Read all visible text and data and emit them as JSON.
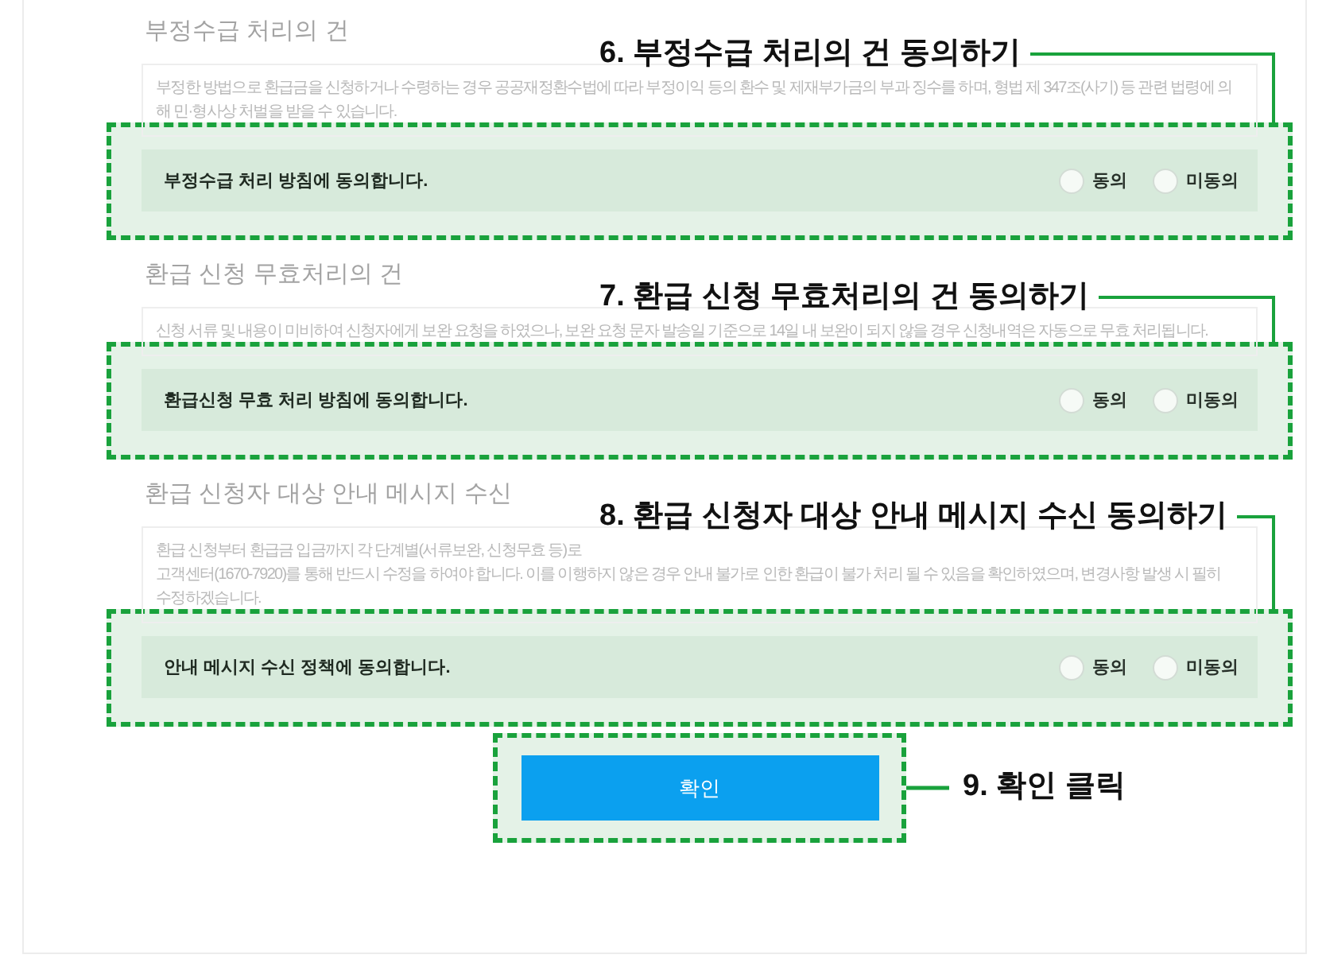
{
  "sections": [
    {
      "title": "부정수급 처리의 건",
      "notice": [
        "부정한 방법으로 환급금을 신청하거나 수령하는 경우 공공재정환수법에 따라 부정이익 등의 환수 및 제재부가금의 부과 징수를 하며, 형법 제 347조(사기) 등 관련 법령에 의",
        "해 민·형사상 처벌을 받을 수 있습니다."
      ],
      "agreement": {
        "text": "부정수급 처리 방침에 동의합니다.",
        "options": [
          {
            "label": "동의",
            "selected": false
          },
          {
            "label": "미동의",
            "selected": false
          }
        ]
      },
      "callout": "6. 부정수급 처리의 건 동의하기"
    },
    {
      "title": "환급 신청 무효처리의 건",
      "notice": [
        "신청 서류 및 내용이 미비하여 신청자에게 보완 요청을 하였으나, 보완 요청 문자 발송일 기준으로 14일 내 보완이 되지 않을 경우 신청내역은 자동으로 무효 처리됩니다."
      ],
      "agreement": {
        "text": "환급신청 무효 처리 방침에 동의합니다.",
        "options": [
          {
            "label": "동의",
            "selected": false
          },
          {
            "label": "미동의",
            "selected": false
          }
        ]
      },
      "callout": "7. 환급 신청 무효처리의 건 동의하기"
    },
    {
      "title": "환급 신청자 대상 안내 메시지 수신",
      "notice": [
        "환급 신청부터 환급금 입금까지 각 단계별(서류보완, 신청무효 등)로",
        "고객센터(1670-7920)를 통해 반드시 수정을 하여야 합니다. 이를 이행하지 않은 경우 안내 불가로 인한 환급이 불가 처리 될 수 있음을 확인하였으며, 변경사항 발생 시 필히",
        "수정하겠습니다."
      ],
      "agreement": {
        "text": "안내 메시지 수신 정책에 동의합니다.",
        "options": [
          {
            "label": "동의",
            "selected": false
          },
          {
            "label": "미동의",
            "selected": false
          }
        ]
      },
      "callout": "8. 환급 신청자 대상 안내 메시지 수신 동의하기"
    }
  ],
  "confirm": {
    "label": "확인",
    "callout": "9. 확인 클릭"
  }
}
